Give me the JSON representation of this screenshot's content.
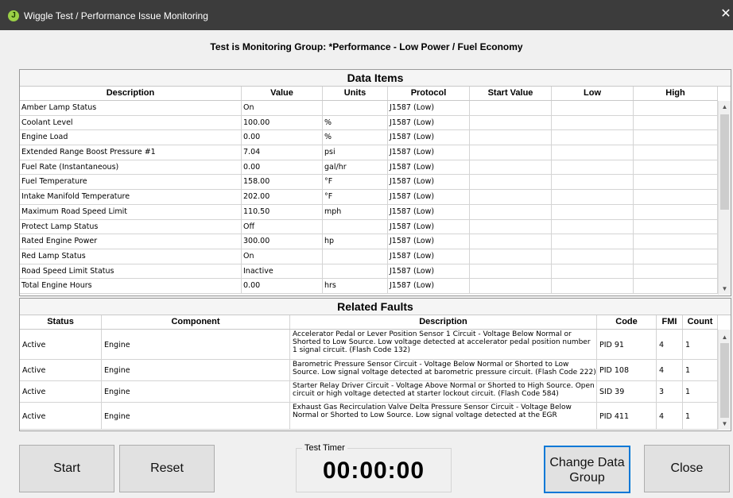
{
  "window": {
    "title": "Wiggle Test / Performance Issue Monitoring"
  },
  "monitor_title": "Test is Monitoring Group: *Performance - Low Power / Fuel Economy",
  "data_items": {
    "header": "Data Items",
    "columns": [
      "Description",
      "Value",
      "Units",
      "Protocol",
      "Start Value",
      "Low",
      "High"
    ],
    "rows": [
      {
        "description": "Amber Lamp Status",
        "value": "On",
        "units": "",
        "protocol": "J1587 (Low)",
        "start": "",
        "low": "",
        "high": ""
      },
      {
        "description": "Coolant Level",
        "value": "100.00",
        "units": "%",
        "protocol": "J1587 (Low)",
        "start": "",
        "low": "",
        "high": ""
      },
      {
        "description": "Engine Load",
        "value": "0.00",
        "units": "%",
        "protocol": "J1587 (Low)",
        "start": "",
        "low": "",
        "high": ""
      },
      {
        "description": "Extended Range Boost Pressure #1",
        "value": "7.04",
        "units": "psi",
        "protocol": "J1587 (Low)",
        "start": "",
        "low": "",
        "high": ""
      },
      {
        "description": "Fuel Rate (Instantaneous)",
        "value": "0.00",
        "units": "gal/hr",
        "protocol": "J1587 (Low)",
        "start": "",
        "low": "",
        "high": ""
      },
      {
        "description": "Fuel Temperature",
        "value": "158.00",
        "units": "°F",
        "protocol": "J1587 (Low)",
        "start": "",
        "low": "",
        "high": ""
      },
      {
        "description": "Intake Manifold Temperature",
        "value": "202.00",
        "units": "°F",
        "protocol": "J1587 (Low)",
        "start": "",
        "low": "",
        "high": ""
      },
      {
        "description": "Maximum Road Speed Limit",
        "value": "110.50",
        "units": "mph",
        "protocol": "J1587 (Low)",
        "start": "",
        "low": "",
        "high": ""
      },
      {
        "description": "Protect Lamp Status",
        "value": "Off",
        "units": "",
        "protocol": "J1587 (Low)",
        "start": "",
        "low": "",
        "high": ""
      },
      {
        "description": "Rated Engine Power",
        "value": "300.00",
        "units": "hp",
        "protocol": "J1587 (Low)",
        "start": "",
        "low": "",
        "high": ""
      },
      {
        "description": "Red Lamp Status",
        "value": "On",
        "units": "",
        "protocol": "J1587 (Low)",
        "start": "",
        "low": "",
        "high": ""
      },
      {
        "description": "Road Speed Limit Status",
        "value": "Inactive",
        "units": "",
        "protocol": "J1587 (Low)",
        "start": "",
        "low": "",
        "high": ""
      },
      {
        "description": "Total Engine Hours",
        "value": "0.00",
        "units": "hrs",
        "protocol": "J1587 (Low)",
        "start": "",
        "low": "",
        "high": ""
      }
    ]
  },
  "related_faults": {
    "header": "Related Faults",
    "columns": [
      "Status",
      "Component",
      "Description",
      "Code",
      "FMI",
      "Count"
    ],
    "rows": [
      {
        "status": "Active",
        "component": "Engine",
        "description": "Accelerator Pedal or Lever Position Sensor 1 Circuit - Voltage Below Normal or Shorted to Low Source. Low voltage detected at accelerator pedal position number 1 signal circuit. (Flash Code 132)",
        "code": "PID 91",
        "fmi": "4",
        "count": "1"
      },
      {
        "status": "Active",
        "component": "Engine",
        "description": "Barometric Pressure Sensor Circuit - Voltage Below Normal or Shorted to Low Source. Low signal voltage detected at barometric pressure circuit. (Flash Code 222)",
        "code": "PID 108",
        "fmi": "4",
        "count": "1"
      },
      {
        "status": "Active",
        "component": "Engine",
        "description": "Starter Relay Driver Circuit - Voltage Above Normal or Shorted to High Source. Open circuit or high voltage detected at starter lockout circuit. (Flash Code 584)",
        "code": "SID 39",
        "fmi": "3",
        "count": "1"
      },
      {
        "status": "Active",
        "component": "Engine",
        "description": "Exhaust Gas Recirculation Valve Delta Pressure Sensor Circuit - Voltage Below Normal or Shorted to Low Source. Low signal voltage detected at the EGR",
        "code": "PID 411",
        "fmi": "4",
        "count": "1"
      }
    ]
  },
  "buttons": {
    "start": "Start",
    "reset": "Reset",
    "change_group_line1": "Change Data",
    "change_group_line2": "Group",
    "close": "Close"
  },
  "timer": {
    "label": "Test Timer",
    "value": "00:00:00"
  },
  "icons": {
    "scroll_up": "▲",
    "scroll_down": "▼",
    "close": "✕",
    "app": "J"
  }
}
